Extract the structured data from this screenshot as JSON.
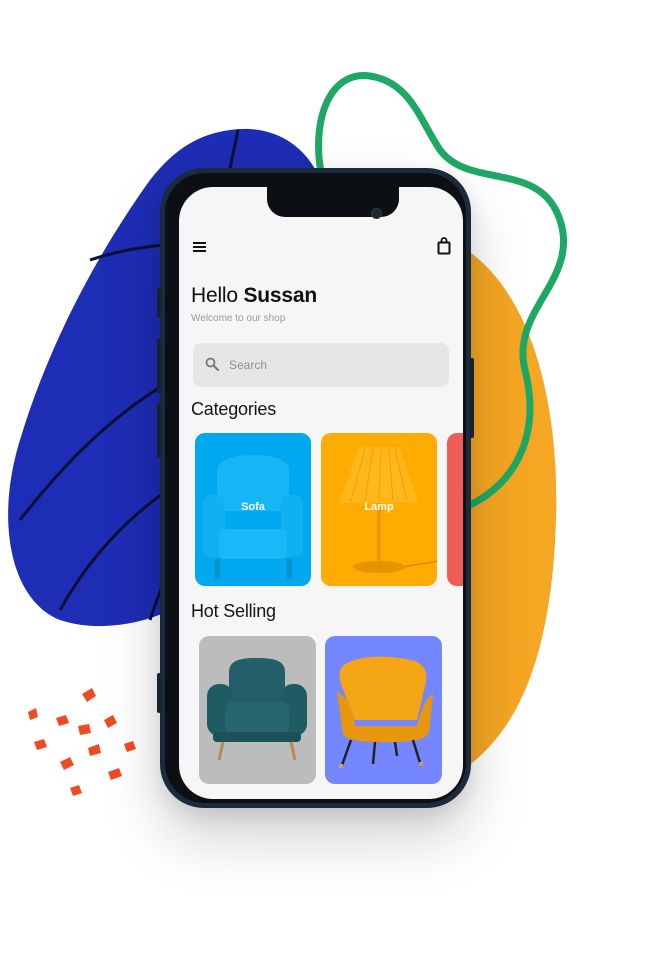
{
  "header": {
    "greeting": "Hello",
    "user_name": "Sussan",
    "subtitle": "Welcome to our shop"
  },
  "search": {
    "placeholder": "Search"
  },
  "sections": {
    "categories_title": "Categories",
    "hot_selling_title": "Hot Selling"
  },
  "categories": [
    {
      "label": "Sofa",
      "color": "#00a8f0"
    },
    {
      "label": "Lamp",
      "color": "#ffab00"
    },
    {
      "label": "",
      "color": "#ef5b55"
    }
  ],
  "hot_selling": [
    {
      "color": "#bcbcbc",
      "product_color": "#1f5b63"
    },
    {
      "color": "#7487ff",
      "product_color": "#f5a614"
    }
  ],
  "icons": {
    "menu": "hamburger-menu-icon",
    "cart": "shopping-bag-icon",
    "search": "search-icon"
  },
  "colors": {
    "blob_blue": "#1e2db5",
    "blob_orange": "#f5a623",
    "squiggle_green": "#1fa865",
    "confetti_orange": "#ef4b23"
  }
}
